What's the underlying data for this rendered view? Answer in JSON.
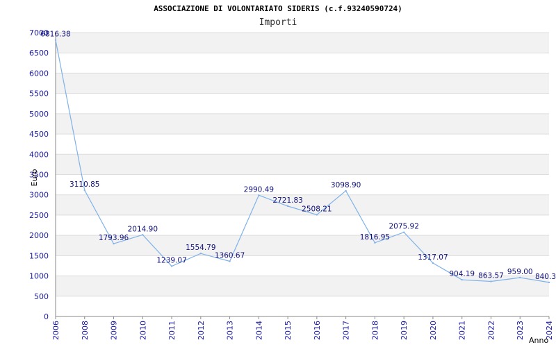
{
  "chart_data": {
    "type": "line",
    "title": "ASSOCIAZIONE DI VOLONTARIATO SIDERIS (c.f.93240590724)",
    "subtitle": "Importi",
    "xlabel": "Anno",
    "ylabel": "Euro",
    "ylim": [
      0,
      7000
    ],
    "yticks": [
      0,
      500,
      1000,
      1500,
      2000,
      2500,
      3000,
      3500,
      4000,
      4500,
      5000,
      5500,
      6000,
      6500,
      7000
    ],
    "grid": true,
    "categories": [
      "2006",
      "2008",
      "2009",
      "2010",
      "2011",
      "2012",
      "2013",
      "2014",
      "2015",
      "2016",
      "2017",
      "2018",
      "2019",
      "2020",
      "2021",
      "2022",
      "2023",
      "2024"
    ],
    "series": [
      {
        "values": [
          6816.38,
          3110.85,
          1793.96,
          2014.9,
          1239.07,
          1554.79,
          1360.67,
          2990.49,
          2721.83,
          2508.21,
          3098.9,
          1816.95,
          2075.92,
          1317.07,
          904.19,
          863.57,
          959.0,
          840.3
        ]
      }
    ],
    "value_labels": [
      "6816.38",
      "3110.85",
      "1793.96",
      "2014.90",
      "1239.07",
      "1554.79",
      "1360.67",
      "2990.49",
      "2721.83",
      "2508.21",
      "3098.90",
      "1816.95",
      "2075.92",
      "1317.07",
      "904.19",
      "863.57",
      "959.00",
      "840.3"
    ],
    "colors": {
      "line": "#7fb2e8",
      "band": "#f2f2f2",
      "grid": "#dddddd",
      "tick_text": "#1a1aa6",
      "label_text": "#10107a"
    }
  }
}
